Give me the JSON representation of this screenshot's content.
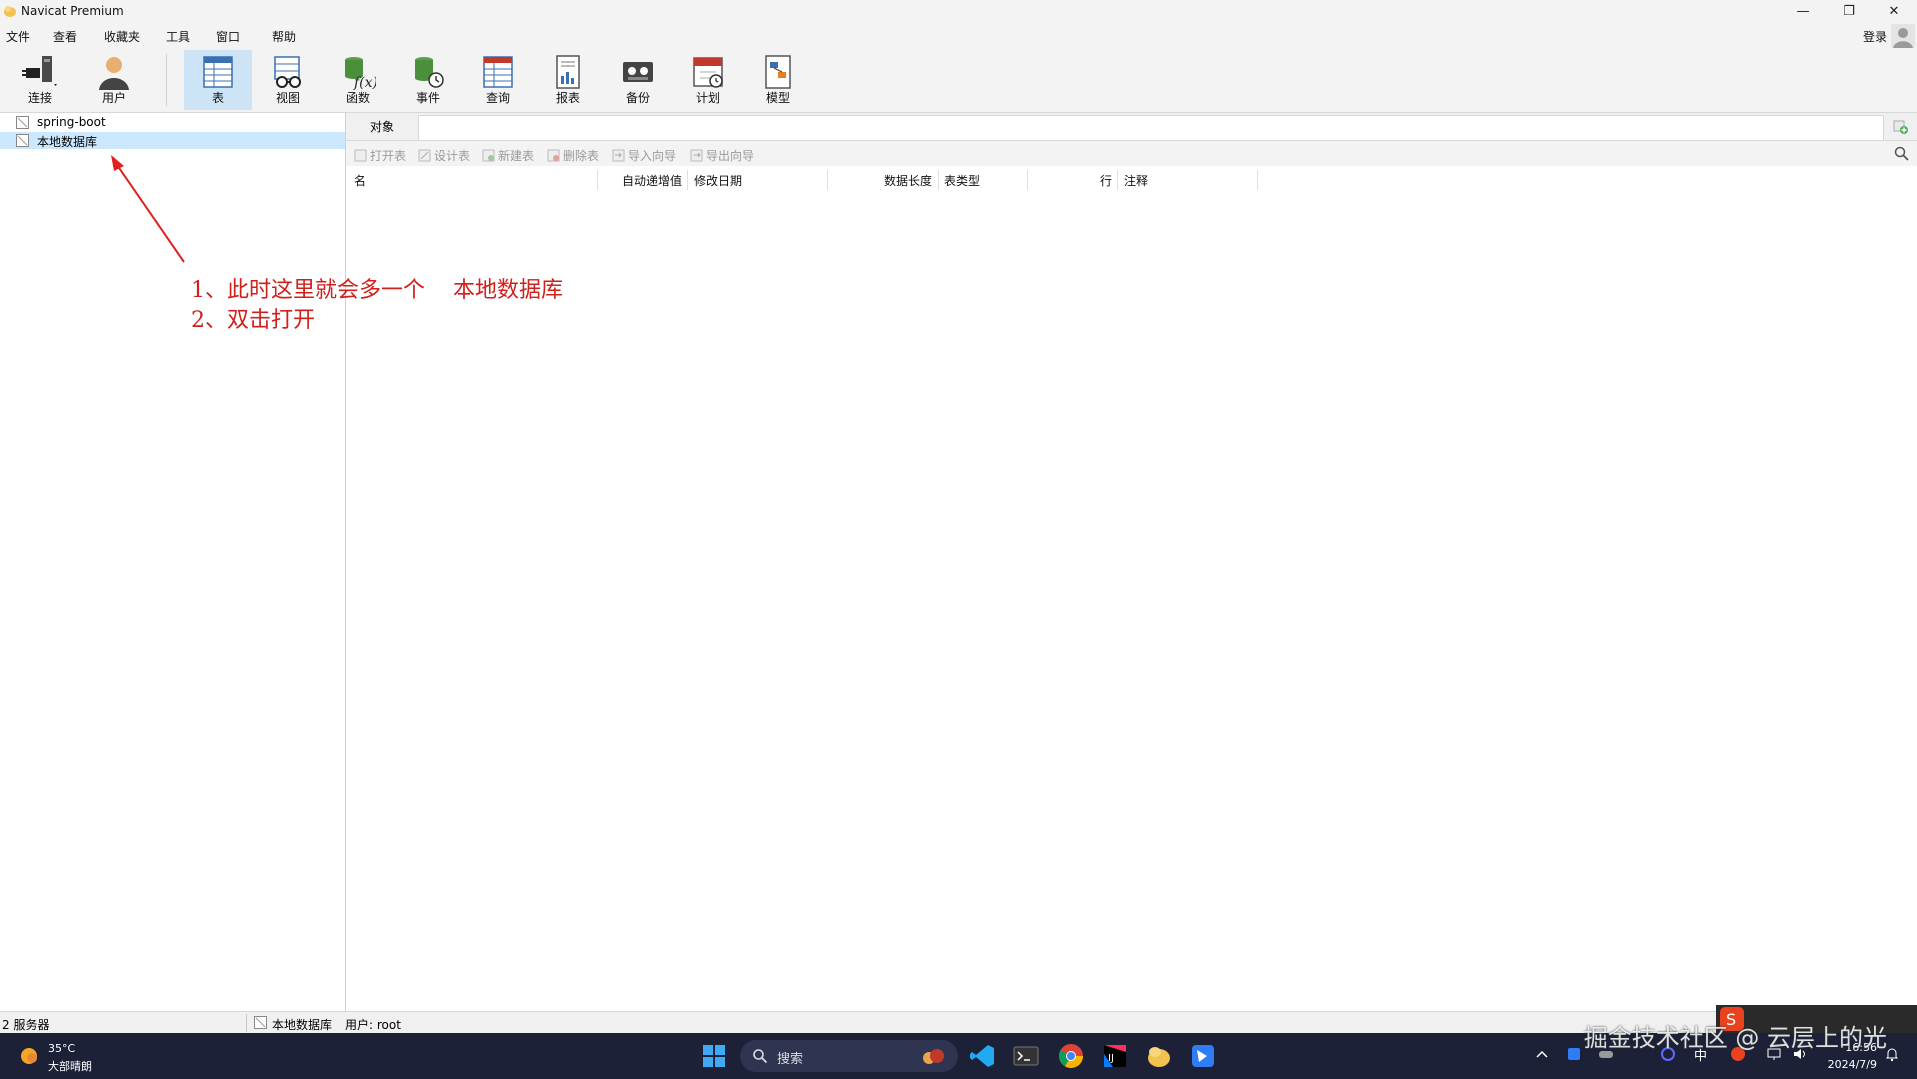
{
  "window": {
    "title": "Navicat Premium",
    "controls": [
      "—",
      "❐",
      "✕"
    ]
  },
  "menu": {
    "items": [
      "文件",
      "查看",
      "收藏夹",
      "工具",
      "窗口",
      "帮助"
    ],
    "login": "登录"
  },
  "toolbar": {
    "items": [
      {
        "label": "连接",
        "icon": "plug-icon"
      },
      {
        "label": "用户",
        "icon": "user-icon"
      },
      {
        "label": "表",
        "icon": "table-icon",
        "active": true
      },
      {
        "label": "视图",
        "icon": "view-icon"
      },
      {
        "label": "函数",
        "icon": "function-icon"
      },
      {
        "label": "事件",
        "icon": "event-icon"
      },
      {
        "label": "查询",
        "icon": "query-icon"
      },
      {
        "label": "报表",
        "icon": "report-icon"
      },
      {
        "label": "备份",
        "icon": "backup-icon"
      },
      {
        "label": "计划",
        "icon": "schedule-icon"
      },
      {
        "label": "模型",
        "icon": "model-icon"
      }
    ]
  },
  "tree": {
    "items": [
      {
        "label": "spring-boot",
        "selected": false
      },
      {
        "label": "本地数据库",
        "selected": true
      }
    ]
  },
  "tabs": {
    "object_tab": "对象"
  },
  "object_toolbar": {
    "buttons": [
      "打开表",
      "设计表",
      "新建表",
      "删除表",
      "导入向导",
      "导出向导"
    ]
  },
  "table_headers": [
    "名",
    "自动递增值",
    "修改日期",
    "数据长度",
    "表类型",
    "行",
    "注释"
  ],
  "annotation": {
    "line1": "1、此时这里就会多一个    本地数据库",
    "line2": "2、双击打开"
  },
  "status": {
    "servers": "2 服务器",
    "connection": "本地数据库",
    "user": "用户: root"
  },
  "taskbar": {
    "weather_temp": "35°C",
    "weather_desc": "大部晴朗",
    "search_placeholder": "搜索",
    "ime_lang": "中",
    "clock_time": "16:56",
    "clock_date": "2024/7/9"
  },
  "watermark": "掘金技术社区 @ 云层上的光",
  "colors": {
    "accent_active": "#cde4f7",
    "selection": "#cce8ff",
    "annotation_red": "#d0201c",
    "taskbar_bg": "#1c2138"
  }
}
